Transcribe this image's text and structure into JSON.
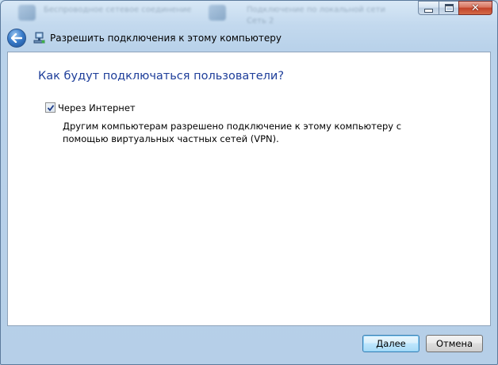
{
  "titlebar": {
    "background_items": [
      "Беспроводное сетевое соединение",
      "Подключение по локальной сети",
      "Сеть 2"
    ],
    "buttons": {
      "minimize_icon": "minimize-icon",
      "maximize_icon": "maximize-icon",
      "close_icon": "close-icon",
      "close_glyph": "✕"
    }
  },
  "nav": {
    "back_icon": "back-arrow-icon",
    "window_icon": "network-connection-icon",
    "title": "Разрешить подключения к этому компьютеру"
  },
  "main": {
    "heading": "Как будут подключаться пользователи?",
    "option": {
      "label": "Через Интернет",
      "checked": true
    },
    "description": "Другим компьютерам разрешено подключение к этому компьютеру с помощью виртуальных частных сетей (VPN)."
  },
  "footer": {
    "next_label": "Далее",
    "cancel_label": "Отмена"
  },
  "colors": {
    "heading": "#1e3e9a",
    "frame": "#b9d2ea",
    "close_button": "#c2432a"
  }
}
